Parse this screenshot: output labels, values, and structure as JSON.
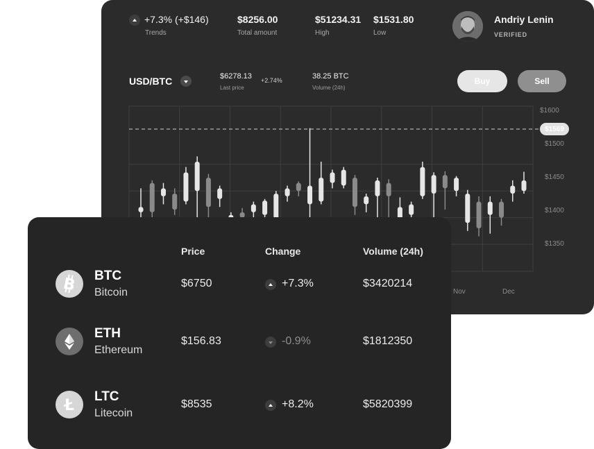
{
  "stats": {
    "trend_value": "+7.3% (+$146)",
    "trend_label": "Trends",
    "total_amount": "$8256.00",
    "total_amount_label": "Total amount",
    "high": "$51234.31",
    "high_label": "High",
    "low": "$1531.80",
    "low_label": "Low"
  },
  "user": {
    "name": "Andriy Lenin",
    "status": "VERIFIED"
  },
  "pair": {
    "name": "USD/BTC",
    "last_price": "$6278.13",
    "last_price_label": "Last price",
    "change": "+2.74%",
    "volume": "38.25 BTC",
    "volume_label": "Volume (24h)"
  },
  "actions": {
    "buy": "Buy",
    "sell": "Sell"
  },
  "chart_data": {
    "type": "candlestick",
    "y_ticks": [
      "$1600",
      "$1500",
      "$1450",
      "$1400",
      "$1350"
    ],
    "current_price_marker": "$1569",
    "x_ticks": [
      "Nov",
      "Dec"
    ],
    "ylim": [
      1330,
      1615
    ],
    "grid": true,
    "candles": [
      {
        "o": 1420,
        "c": 1410,
        "h": 1455,
        "l": 1395,
        "tone": "light"
      },
      {
        "o": 1410,
        "c": 1465,
        "h": 1470,
        "l": 1395,
        "tone": "mid"
      },
      {
        "o": 1455,
        "c": 1440,
        "h": 1465,
        "l": 1425,
        "tone": "light"
      },
      {
        "o": 1445,
        "c": 1415,
        "h": 1455,
        "l": 1405,
        "tone": "mid"
      },
      {
        "o": 1430,
        "c": 1485,
        "h": 1495,
        "l": 1425,
        "tone": "light"
      },
      {
        "o": 1450,
        "c": 1505,
        "h": 1515,
        "l": 1390,
        "tone": "light"
      },
      {
        "o": 1475,
        "c": 1420,
        "h": 1482,
        "l": 1385,
        "tone": "mid"
      },
      {
        "o": 1435,
        "c": 1455,
        "h": 1460,
        "l": 1420,
        "tone": "light"
      },
      {
        "o": 1395,
        "c": 1405,
        "h": 1410,
        "l": 1390,
        "tone": "light"
      },
      {
        "o": 1400,
        "c": 1410,
        "h": 1418,
        "l": 1395,
        "tone": "mid"
      },
      {
        "o": 1410,
        "c": 1425,
        "h": 1430,
        "l": 1400,
        "tone": "light"
      },
      {
        "o": 1405,
        "c": 1432,
        "h": 1435,
        "l": 1400,
        "tone": "light"
      },
      {
        "o": 1390,
        "c": 1445,
        "h": 1450,
        "l": 1385,
        "tone": "light"
      },
      {
        "o": 1440,
        "c": 1455,
        "h": 1460,
        "l": 1430,
        "tone": "light"
      },
      {
        "o": 1450,
        "c": 1465,
        "h": 1468,
        "l": 1440,
        "tone": "mid"
      },
      {
        "o": 1425,
        "c": 1460,
        "h": 1568,
        "l": 1400,
        "tone": "light"
      },
      {
        "o": 1430,
        "c": 1475,
        "h": 1505,
        "l": 1425,
        "tone": "light"
      },
      {
        "o": 1465,
        "c": 1485,
        "h": 1490,
        "l": 1455,
        "tone": "light"
      },
      {
        "o": 1460,
        "c": 1490,
        "h": 1495,
        "l": 1455,
        "tone": "light"
      },
      {
        "o": 1475,
        "c": 1420,
        "h": 1480,
        "l": 1405,
        "tone": "mid"
      },
      {
        "o": 1440,
        "c": 1425,
        "h": 1445,
        "l": 1410,
        "tone": "light"
      },
      {
        "o": 1440,
        "c": 1470,
        "h": 1475,
        "l": 1395,
        "tone": "light"
      },
      {
        "o": 1465,
        "c": 1440,
        "h": 1472,
        "l": 1400,
        "tone": "mid"
      },
      {
        "o": 1420,
        "c": 1390,
        "h": 1438,
        "l": 1385,
        "tone": "light"
      },
      {
        "o": 1405,
        "c": 1425,
        "h": 1430,
        "l": 1398,
        "tone": "light"
      },
      {
        "o": 1440,
        "c": 1495,
        "h": 1505,
        "l": 1435,
        "tone": "light"
      },
      {
        "o": 1445,
        "c": 1480,
        "h": 1485,
        "l": 1400,
        "tone": "light"
      },
      {
        "o": 1455,
        "c": 1480,
        "h": 1487,
        "l": 1415,
        "tone": "mid"
      },
      {
        "o": 1450,
        "c": 1475,
        "h": 1478,
        "l": 1440,
        "tone": "light"
      },
      {
        "o": 1445,
        "c": 1390,
        "h": 1452,
        "l": 1375,
        "tone": "light"
      },
      {
        "o": 1430,
        "c": 1380,
        "h": 1440,
        "l": 1365,
        "tone": "mid"
      },
      {
        "o": 1405,
        "c": 1430,
        "h": 1440,
        "l": 1370,
        "tone": "light"
      },
      {
        "o": 1400,
        "c": 1430,
        "h": 1435,
        "l": 1385,
        "tone": "mid"
      },
      {
        "o": 1445,
        "c": 1460,
        "h": 1470,
        "l": 1430,
        "tone": "light"
      },
      {
        "o": 1450,
        "c": 1470,
        "h": 1486,
        "l": 1445,
        "tone": "light"
      }
    ]
  },
  "table": {
    "headers": {
      "price": "Price",
      "change": "Change",
      "volume": "Volume (24h)"
    },
    "rows": [
      {
        "symbol": "BTC",
        "name": "Bitcoin",
        "price": "$6750",
        "change": "+7.3%",
        "direction": "up",
        "volume": "$3420214",
        "icon": "bitcoin-icon"
      },
      {
        "symbol": "ETH",
        "name": "Ethereum",
        "price": "$156.83",
        "change": "-0.9%",
        "direction": "down",
        "volume": "$1812350",
        "icon": "ethereum-icon"
      },
      {
        "symbol": "LTC",
        "name": "Litecoin",
        "price": "$8535",
        "change": "+8.2%",
        "direction": "up",
        "volume": "$5820399",
        "icon": "litecoin-icon"
      }
    ]
  },
  "colors": {
    "card_back": "#2b2b2b",
    "card_front": "#252525",
    "buy": "#e6e6e6",
    "sell": "#8f8f8f"
  }
}
